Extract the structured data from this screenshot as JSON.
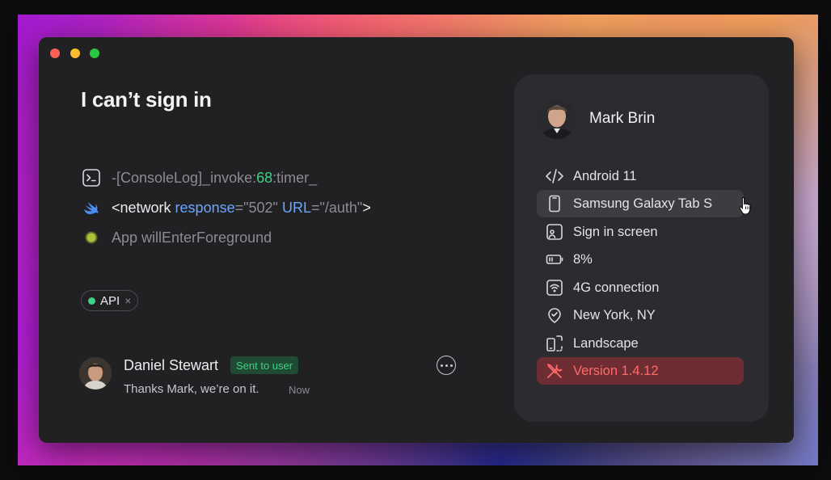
{
  "window": {
    "controls": [
      "close",
      "minimize",
      "zoom"
    ]
  },
  "issue": {
    "title": "I can’t sign in"
  },
  "logs": {
    "console": {
      "icon": "terminal-icon",
      "prefix": "-[ConsoleLog]_invoke:",
      "number": "68",
      "suffix": ":timer_"
    },
    "network": {
      "icon": "swift-bird-icon",
      "open": "<network ",
      "attr1": "response",
      "eq1": "=",
      "val1": "\"502\"",
      "attr2": "URL",
      "eq2": "=",
      "val2": "\"/auth\"",
      "close": ">"
    },
    "lifecycle": {
      "icon": "status-dot-icon",
      "text": "App willEnterForeground"
    }
  },
  "tag": {
    "label": "API",
    "remove": "×"
  },
  "message": {
    "author": "Daniel Stewart",
    "badge": "Sent to user",
    "text": "Thanks Mark, we’re on it.",
    "time": "Now"
  },
  "user_panel": {
    "name": "Mark Brin",
    "details": [
      {
        "icon": "code-icon",
        "label": "Android 11"
      },
      {
        "icon": "device-icon",
        "label": "Samsung Galaxy Tab S"
      },
      {
        "icon": "screen-user-icon",
        "label": "Sign in screen"
      },
      {
        "icon": "battery-icon",
        "label": "8%"
      },
      {
        "icon": "wifi-icon",
        "label": "4G connection"
      },
      {
        "icon": "location-icon",
        "label": "New York, NY"
      },
      {
        "icon": "rotate-icon",
        "label": "Landscape"
      },
      {
        "icon": "tools-icon",
        "label": "Version 1.4.12"
      }
    ]
  },
  "colors": {
    "accent_green": "#3ed286",
    "accent_blue": "#6aa6ff",
    "alert_red": "#ff6b6b",
    "alert_bg": "#6e2d32"
  }
}
